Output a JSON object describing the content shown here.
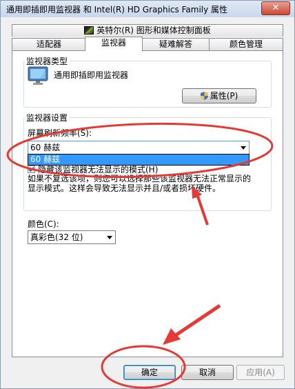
{
  "window": {
    "title": "通用即插即用监视器 和 Intel(R) HD Graphics Family 属性",
    "close_glyph": "✕"
  },
  "tabs": {
    "row1": [
      {
        "label": "英特尔(R) 图形和媒体控制面板"
      }
    ],
    "row2": [
      {
        "label": "适配器"
      },
      {
        "label": "监视器"
      },
      {
        "label": "疑难解答"
      },
      {
        "label": "颜色管理"
      }
    ],
    "active": "监视器"
  },
  "monitor_type": {
    "group_label": "监视器类型",
    "monitor_name": "通用即插即用监视器",
    "monitor_icon": "monitor-icon",
    "properties_button": "属性(P)",
    "shield_icon": "uac-shield-icon"
  },
  "monitor_settings": {
    "group_label": "监视器设置",
    "refresh_label": "屏幕刷新频率(S):",
    "refresh_value": "60 赫兹",
    "refresh_options": [
      "60 赫兹"
    ],
    "hide_modes_label": "隐藏该监视器无法显示的模式(H)",
    "hide_modes_checked": true,
    "warning_line1": "如果不复选该项，则您可以选择那些该监视器无法正常显示的",
    "warning_line2": "显示模式。这样会导致无法显示并且/或者损坏硬件。"
  },
  "color": {
    "label": "颜色(C):",
    "value": "真彩色(32 位)"
  },
  "footer": {
    "ok": "确定",
    "cancel": "取消",
    "apply": "应用(A)"
  },
  "annotation_color": "#e53935"
}
